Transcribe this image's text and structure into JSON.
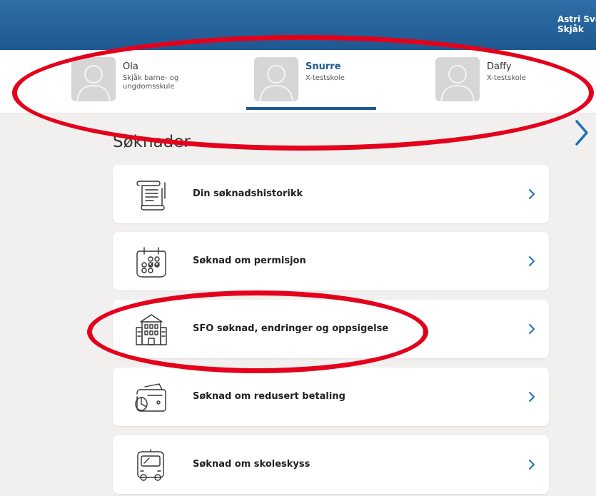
{
  "header": {
    "user_name": "Astri Sve",
    "user_place": "Skjåk"
  },
  "children": [
    {
      "name": "Ola",
      "school": "Skjåk barne- og ungdomsskule",
      "active": false
    },
    {
      "name": "Snurre",
      "school": "X-testskole",
      "active": true
    },
    {
      "name": "Daffy",
      "school": "X-testskole",
      "active": false
    }
  ],
  "section": {
    "title": "Søknader"
  },
  "items": [
    {
      "label": "Din søknadshistorikk",
      "icon": "scroll-icon"
    },
    {
      "label": "Søknad om permisjon",
      "icon": "calendar-icon"
    },
    {
      "label": "SFO søknad, endringer og oppsigelse",
      "icon": "school-building-icon"
    },
    {
      "label": "Søknad om redusert betaling",
      "icon": "wallet-icon"
    },
    {
      "label": "Søknad om skoleskyss",
      "icon": "bus-icon"
    }
  ],
  "colors": {
    "primary": "#1f5890",
    "annotation": "#e4001b",
    "background": "#f1f0ef"
  }
}
